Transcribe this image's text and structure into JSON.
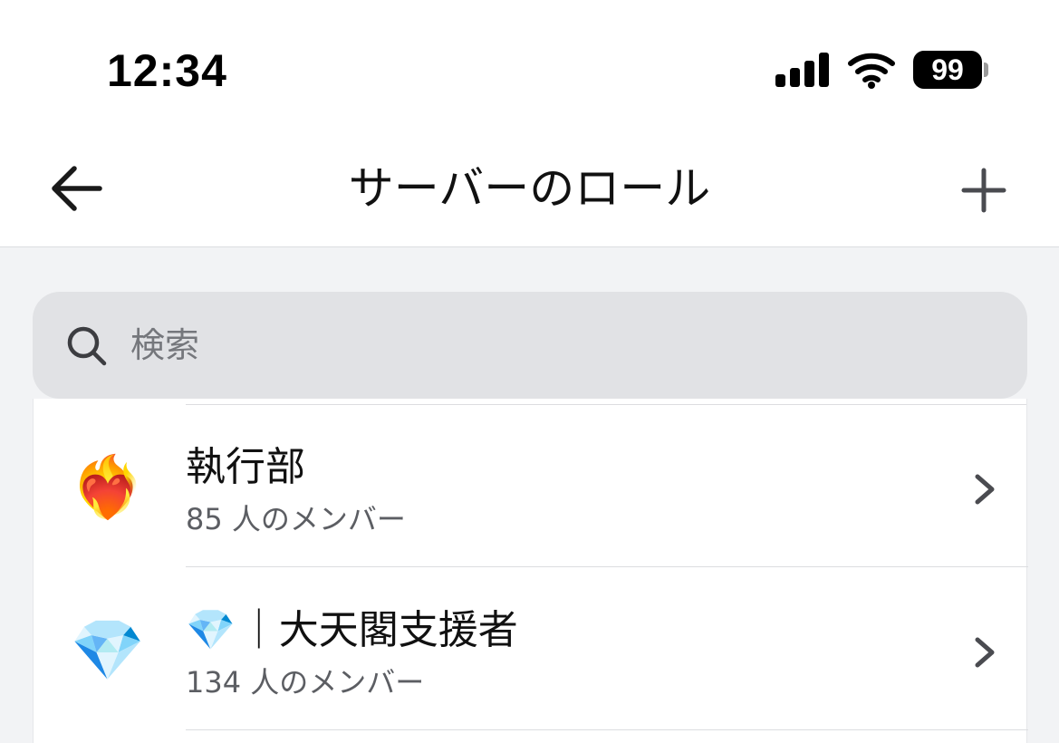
{
  "status_bar": {
    "time": "12:34",
    "battery": "99"
  },
  "header": {
    "title": "サーバーのロール",
    "back_icon": "arrow-left-icon",
    "add_icon": "plus-icon"
  },
  "search": {
    "placeholder": "検索",
    "value": "",
    "icon": "search-icon"
  },
  "roles": [
    {
      "icon": "❤️‍🔥",
      "name_prefix": "",
      "name": "執行部",
      "member_count": "85 人のメンバー"
    },
    {
      "icon": "💎",
      "name_prefix": "💎",
      "name": "｜大天閣支援者",
      "member_count": "134 人のメンバー"
    }
  ],
  "colors": {
    "background": "#f2f3f5",
    "surface": "#ffffff",
    "search_fill": "#e1e2e5",
    "secondary_text": "#5c5e63"
  }
}
